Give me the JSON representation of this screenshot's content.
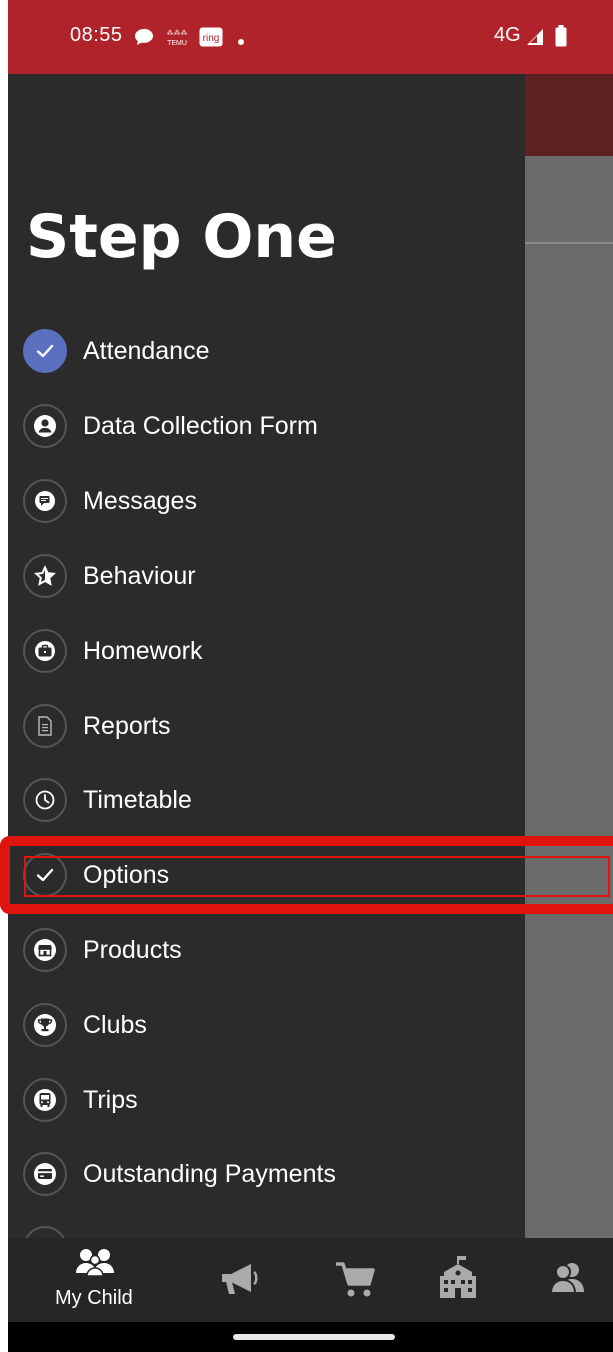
{
  "status_bar": {
    "time": "08:55",
    "notification_icons": [
      "chat-bubble-icon",
      "temu-icon",
      "ring-icon",
      "dot-icon"
    ],
    "ring_label": "ring",
    "temu_label": "TEMU",
    "network": "4G",
    "signal_icon": "signal-icon",
    "battery_icon": "battery-icon"
  },
  "overlay_title": "Step One",
  "menu": {
    "items": [
      {
        "label": "Attendance",
        "icon": "check-icon",
        "active": true
      },
      {
        "label": "Data Collection Form",
        "icon": "person-icon"
      },
      {
        "label": "Messages",
        "icon": "chat-icon"
      },
      {
        "label": "Behaviour",
        "icon": "star-icon"
      },
      {
        "label": "Homework",
        "icon": "briefcase-icon"
      },
      {
        "label": "Reports",
        "icon": "document-icon"
      },
      {
        "label": "Timetable",
        "icon": "clock-icon"
      },
      {
        "label": "Options",
        "icon": "check-icon",
        "highlighted": true
      },
      {
        "label": "Products",
        "icon": "store-icon"
      },
      {
        "label": "Clubs",
        "icon": "trophy-icon"
      },
      {
        "label": "Trips",
        "icon": "bus-icon"
      },
      {
        "label": "Outstanding Payments",
        "icon": "credit-card-icon"
      }
    ]
  },
  "bottom_nav": {
    "items": [
      {
        "label": "My Child",
        "icon": "people-icon",
        "active": true
      },
      {
        "label": "",
        "icon": "megaphone-icon"
      },
      {
        "label": "",
        "icon": "cart-icon"
      },
      {
        "label": "",
        "icon": "school-icon"
      },
      {
        "label": "",
        "icon": "contacts-icon"
      }
    ]
  },
  "colors": {
    "status_bar": "#b1232a",
    "drawer_bg": "#2b2b2b",
    "active_icon_bg": "#5b6fbf",
    "highlight": "#e0140f",
    "bottom_nav_bg": "#262626"
  }
}
